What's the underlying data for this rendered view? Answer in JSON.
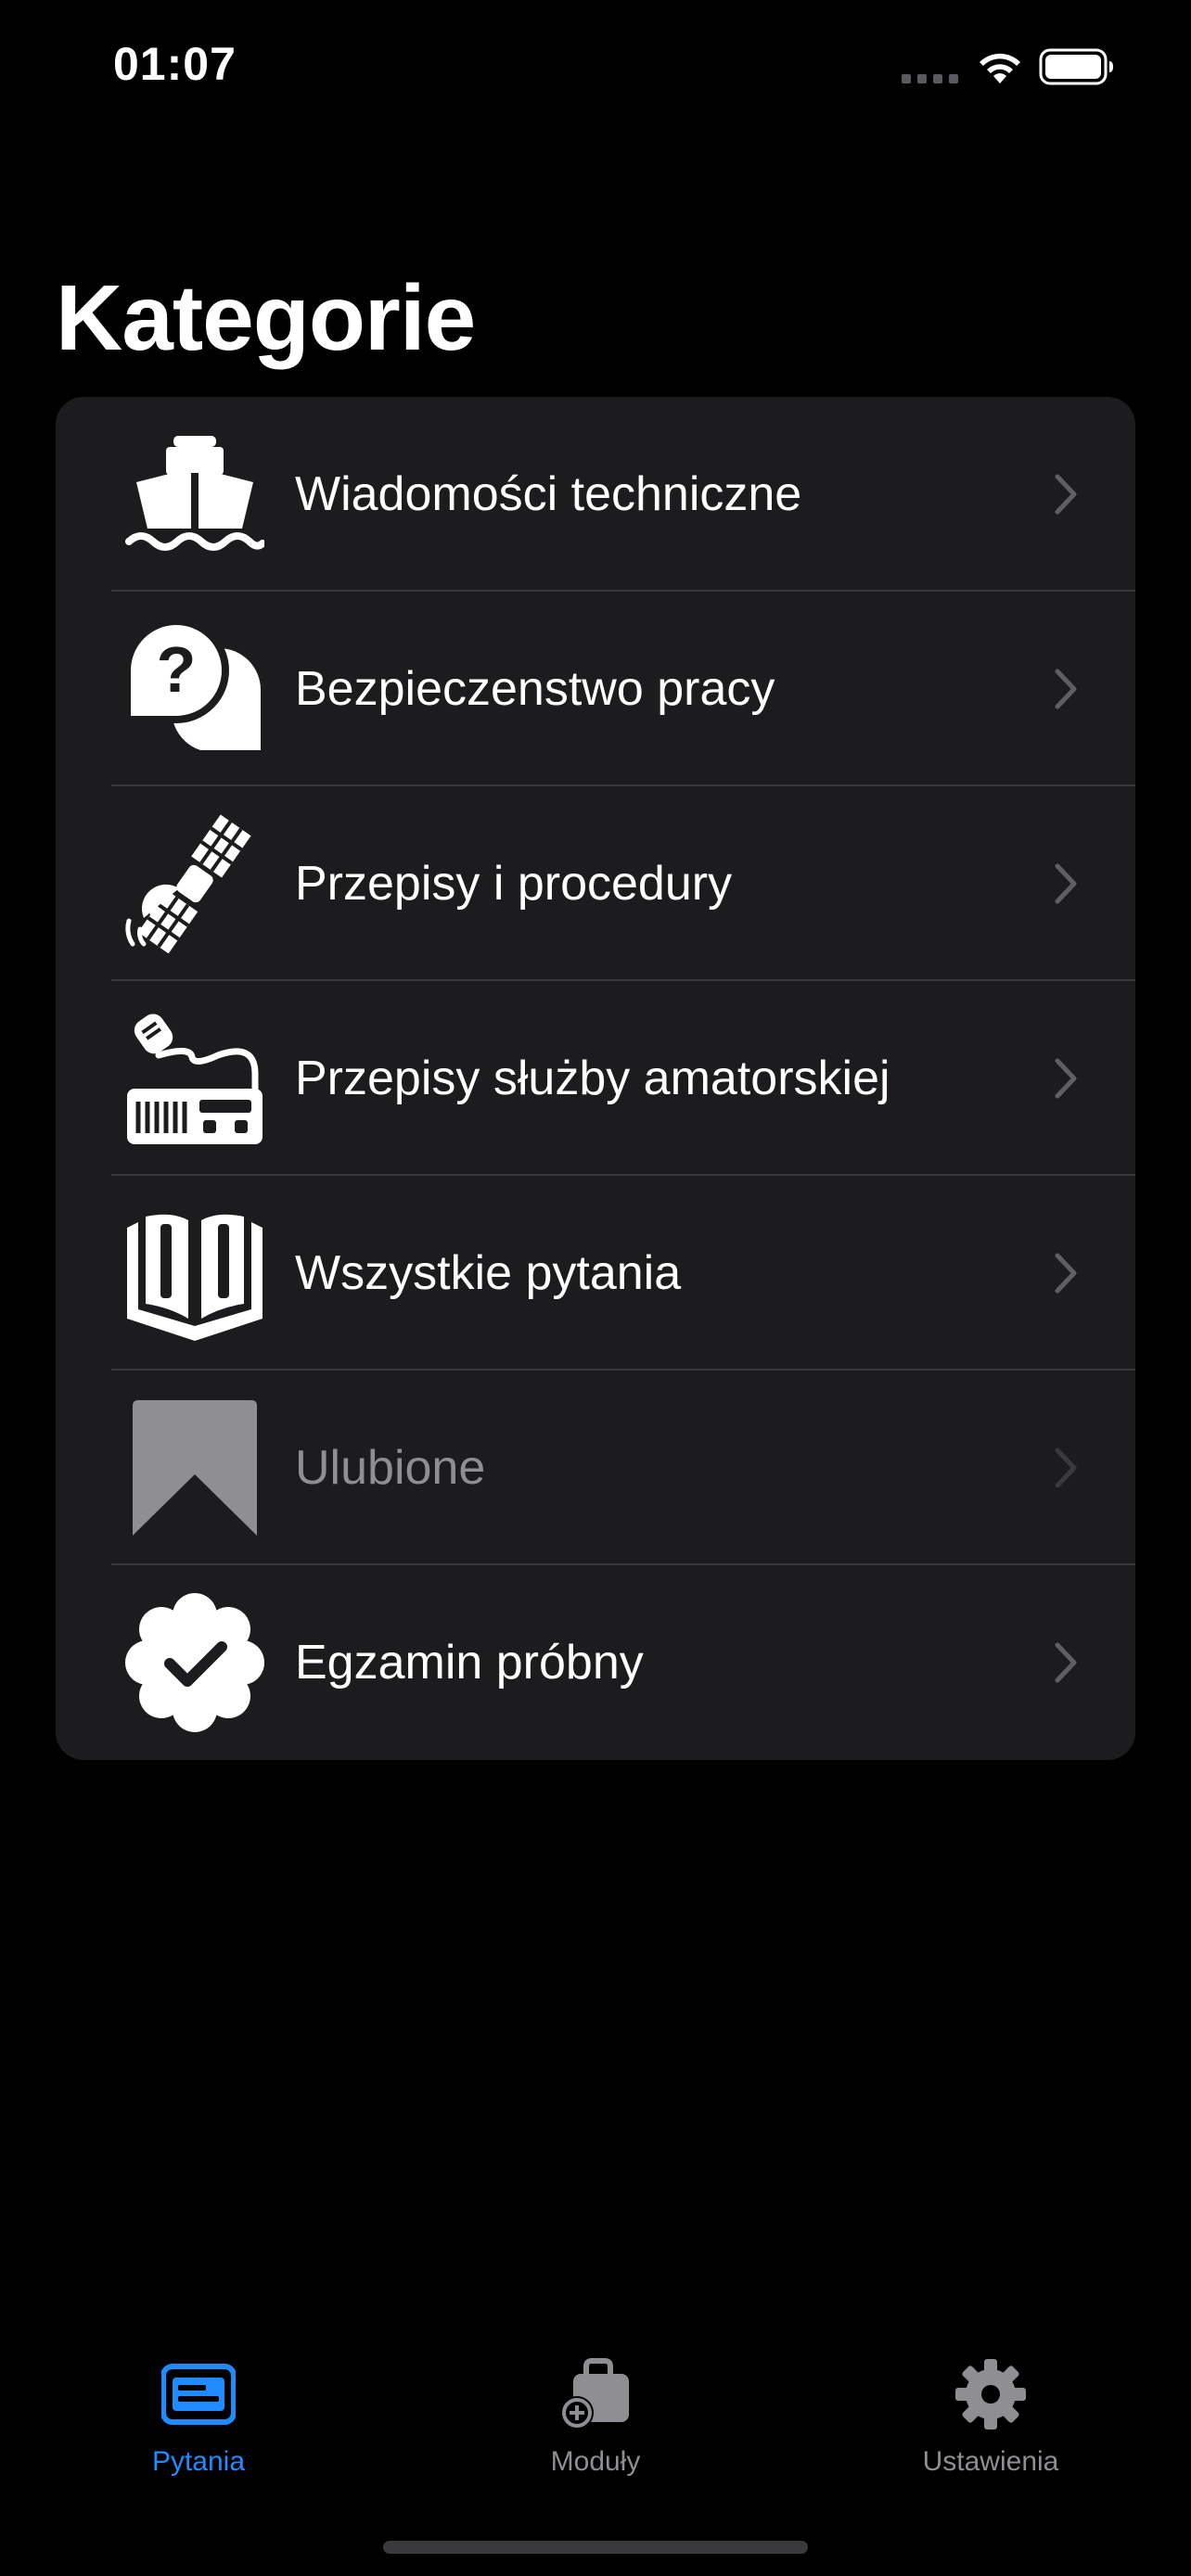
{
  "status_bar": {
    "time": "01:07"
  },
  "page": {
    "title": "Kategorie"
  },
  "categories": [
    {
      "label": "Wiadomości techniczne",
      "icon": "ship-icon",
      "enabled": true
    },
    {
      "label": "Bezpieczenstwo pracy",
      "icon": "question-bubbles-icon",
      "enabled": true
    },
    {
      "label": "Przepisy i procedury",
      "icon": "satellite-icon",
      "enabled": true
    },
    {
      "label": "Przepisy służby amatorskiej",
      "icon": "radio-transceiver-icon",
      "enabled": true
    },
    {
      "label": "Wszystkie pytania",
      "icon": "book-icon",
      "enabled": true
    },
    {
      "label": "Ulubione",
      "icon": "bookmark-icon",
      "enabled": false
    },
    {
      "label": "Egzamin próbny",
      "icon": "checkmark-badge-icon",
      "enabled": true
    }
  ],
  "tab_bar": {
    "tabs": [
      {
        "label": "Pytania",
        "icon": "card-icon",
        "active": true
      },
      {
        "label": "Moduły",
        "icon": "bag-add-icon",
        "active": false
      },
      {
        "label": "Ustawienia",
        "icon": "gear-icon",
        "active": false
      }
    ]
  },
  "colors": {
    "background": "#000000",
    "card": "#1c1c1e",
    "divider": "#38383a",
    "accent": "#1f8bff",
    "secondary_text": "#8e8e93"
  }
}
